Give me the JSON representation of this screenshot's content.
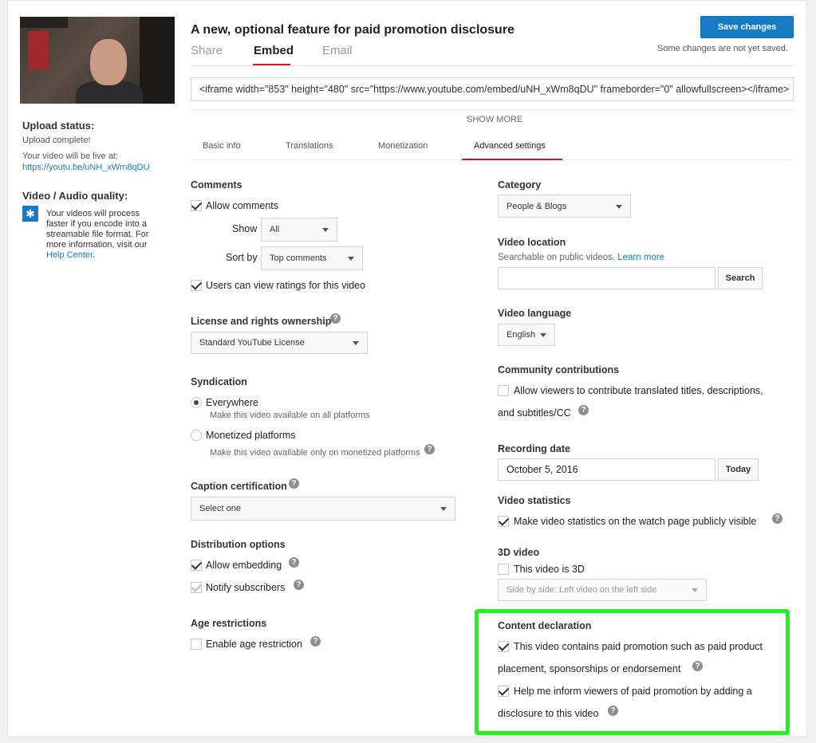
{
  "header": {
    "title": "A new, optional feature for paid promotion disclosure",
    "tabs": [
      "Share",
      "Embed",
      "Email"
    ],
    "save_label": "Save changes",
    "save_status": "Some changes are not yet saved."
  },
  "embed_code": "<iframe width=\"853\" height=\"480\" src=\"https://www.youtube.com/embed/uNH_xWm8qDU\" frameborder=\"0\" allowfullscreen></iframe>",
  "show_more": "SHOW MORE",
  "subtabs": [
    "Basic info",
    "Translations",
    "Monetization",
    "Advanced settings"
  ],
  "left": {
    "upload_heading": "Upload status:",
    "upload_status": "Upload complete!",
    "live_text": "Your video will be live at:",
    "live_url": "https://youtu.be/uNH_xWm8qDU",
    "quality_heading": "Video / Audio quality:",
    "quality_text": "Your videos will process faster if you encode into a streamable file format. For more information, visit our",
    "help_link": "Help Center",
    "period": "."
  },
  "comments": {
    "heading": "Comments",
    "allow_label": "Allow comments",
    "show_label": "Show",
    "show_value": "All",
    "sort_label": "Sort by",
    "sort_value": "Top comments",
    "ratings_label": "Users can view ratings for this video"
  },
  "license": {
    "heading": "License and rights ownership",
    "value": "Standard YouTube License"
  },
  "syndication": {
    "heading": "Syndication",
    "everywhere": "Everywhere",
    "everywhere_desc": "Make this video available on all platforms",
    "monetized": "Monetized platforms",
    "monetized_desc": "Make this video available only on monetized platforms"
  },
  "caption": {
    "heading": "Caption certification",
    "value": "Select one"
  },
  "distribution": {
    "heading": "Distribution options",
    "embedding": "Allow embedding",
    "notify": "Notify subscribers"
  },
  "age": {
    "heading": "Age restrictions",
    "label": "Enable age restriction"
  },
  "category": {
    "heading": "Category",
    "value": "People & Blogs"
  },
  "location": {
    "heading": "Video location",
    "desc": "Searchable on public videos.",
    "learn_more": "Learn more",
    "search_label": "Search"
  },
  "language": {
    "heading": "Video language",
    "value": "English"
  },
  "community": {
    "heading": "Community contributions",
    "line1": "Allow viewers to contribute translated titles, descriptions,",
    "line2": "and subtitles/CC"
  },
  "recording": {
    "heading": "Recording date",
    "value": "October 5, 2016",
    "today_label": "Today"
  },
  "statistics": {
    "heading": "Video statistics",
    "label": "Make video statistics on the watch page publicly visible"
  },
  "video3d": {
    "heading": "3D video",
    "label": "This video is 3D",
    "dropdown": "Side by side: Left video on the left side"
  },
  "content_declaration": {
    "heading": "Content declaration",
    "paid_line1": "This video contains paid promotion such as paid product",
    "paid_line2": "placement, sponsorships or endorsement",
    "inform_line1": "Help me inform viewers of paid promotion by adding a",
    "inform_line2": "disclosure to this video"
  },
  "help_glyph": "?",
  "star_glyph": "✱",
  "colors": {
    "link": "#167ac6",
    "primary_button": "#167ac6",
    "tab_underline": "#cc181e",
    "highlight": "#1ef51e"
  }
}
